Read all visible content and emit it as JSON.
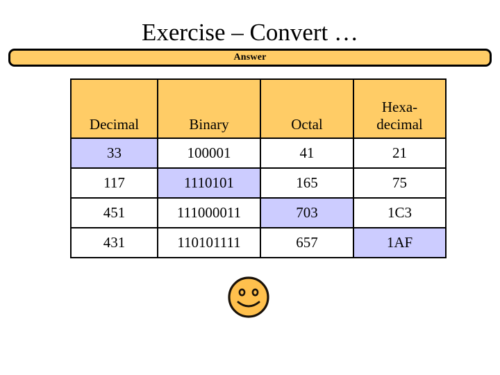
{
  "slide": {
    "title": "Exercise – Convert …",
    "banner_label": "Answer",
    "accent_orange": "#FFCC66",
    "highlight_lavender": "#CCCCFF",
    "outline_color": "#000000"
  },
  "table": {
    "columns": [
      {
        "label": "Decimal",
        "key": "decimal"
      },
      {
        "label": "Binary",
        "key": "binary"
      },
      {
        "label": "Octal",
        "key": "octal"
      },
      {
        "label_line1": "Hexa-",
        "label_line2": "decimal",
        "key": "hexadecimal"
      }
    ],
    "rows": [
      {
        "decimal": "33",
        "binary": "100001",
        "octal": "41",
        "hexadecimal": "21",
        "highlight": "decimal"
      },
      {
        "decimal": "117",
        "binary": "1110101",
        "octal": "165",
        "hexadecimal": "75",
        "highlight": "binary"
      },
      {
        "decimal": "451",
        "binary": "111000011",
        "octal": "703",
        "hexadecimal": "1C3",
        "highlight": "octal"
      },
      {
        "decimal": "431",
        "binary": "110101111",
        "octal": "657",
        "hexadecimal": "1AF",
        "highlight": "hexadecimal"
      }
    ]
  },
  "decoration": {
    "smiley_icon": "smiley-face",
    "smiley_fill": "#FFC04D"
  }
}
